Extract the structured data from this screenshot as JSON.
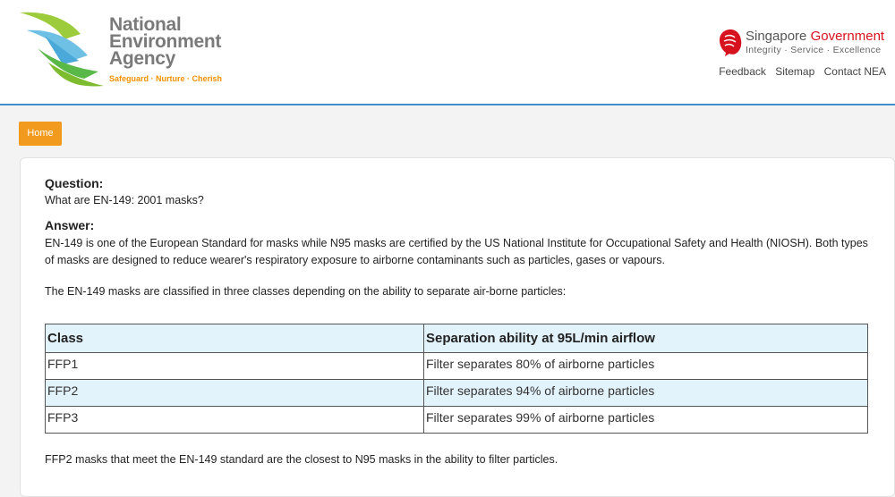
{
  "header": {
    "logo": {
      "line1": "National",
      "line2": "Environment",
      "line3": "Agency",
      "tagline": "Safeguard · Nurture · Cherish"
    },
    "gov": {
      "name_part1": "Singapore ",
      "name_part2": "Government",
      "motto": "Integrity · Service · Excellence",
      "icon": "lion-head-icon"
    },
    "links": [
      "Feedback",
      "Sitemap",
      "Contact NEA"
    ]
  },
  "nav": {
    "home": "Home"
  },
  "faq": {
    "question_label": "Question:",
    "question": "What are EN-149: 2001 masks?",
    "answer_label": "Answer:",
    "answer": "EN-149 is one of the European Standard for masks while N95 masks are certified by the US National Institute for Occupational Safety and Health (NIOSH). Both types of masks are designed to reduce wearer's respiratory exposure to airborne contaminants such as particles, gases or vapours.",
    "classes_intro": "The EN-149 masks are classified in three classes depending on the ability to separate air-borne particles:",
    "table": {
      "headers": [
        "Class",
        "Separation ability at 95L/min airflow"
      ],
      "rows": [
        [
          "FFP1",
          "Filter separates 80% of airborne particles"
        ],
        [
          "FFP2",
          "Filter separates 94% of airborne particles"
        ],
        [
          "FFP3",
          "Filter separates 99% of airborne particles"
        ]
      ]
    },
    "closing": "FFP2 masks that meet the EN-149 standard are the closest to N95 masks in the ability to filter particles."
  },
  "colors": {
    "accent_orange": "#f29a1e",
    "header_rule_blue": "#3f8fcb",
    "table_shade": "#e3f3fb",
    "gov_red": "#d7121f"
  }
}
